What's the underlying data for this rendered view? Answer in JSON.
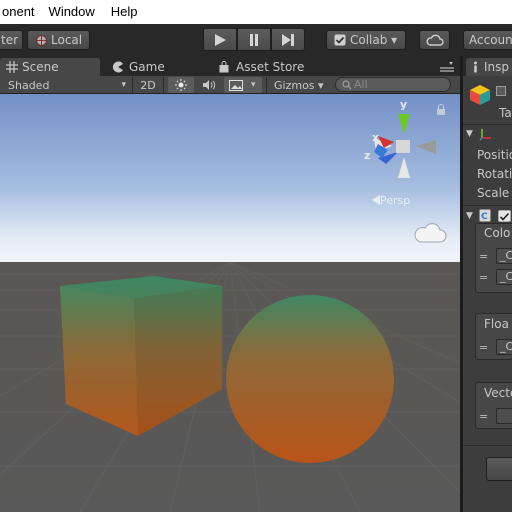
{
  "menu": {
    "items": [
      "onent",
      "Window",
      "Help"
    ]
  },
  "toolbar": {
    "pivot_label": "ter",
    "space_label": "Local",
    "collab_label": "Collab ▾",
    "account_label": "Accoun"
  },
  "tabs": {
    "scene": "Scene",
    "game": "Game",
    "asset_store": "Asset Store",
    "inspector": "Insp"
  },
  "scene_toolbar": {
    "draw_mode": "Shaded",
    "mode_2d": "2D",
    "gizmos": "Gizmos ▾",
    "search_placeholder": "All"
  },
  "gizmo": {
    "y": "y",
    "x": "x",
    "z": "z",
    "view_label": "Persp"
  },
  "inspector": {
    "object_label": "Ta",
    "transform": {
      "position": "Positio",
      "rotation": "Rotatio",
      "scale": "Scale"
    },
    "colors_header": "Colo",
    "color_fields": [
      "_C",
      "_C"
    ],
    "floats_header": "Floa",
    "float_fields": [
      "_C"
    ],
    "vectors_header": "Vecto",
    "vector_fields": [
      ""
    ]
  }
}
